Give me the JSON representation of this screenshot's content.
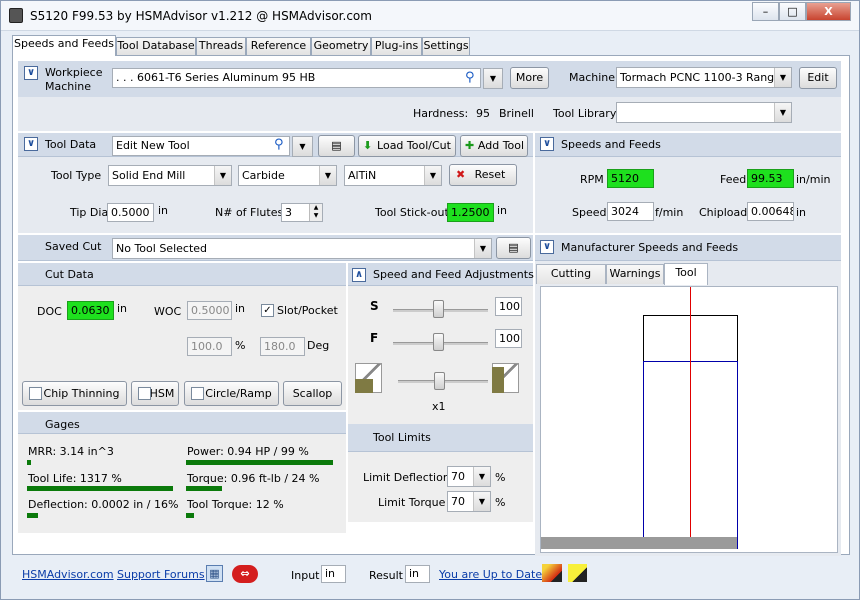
{
  "window": {
    "title": "S5120 F99.53 by HSMAdvisor v1.212 @ HSMAdvisor.com",
    "minimize": "–",
    "maximize": "□",
    "close": "X"
  },
  "tabs": [
    "Speeds and Feeds",
    "Tool Database",
    "Threads",
    "Reference",
    "Geometry",
    "Plug-ins",
    "Settings"
  ],
  "workpiece": {
    "label_line1": "Workpiece",
    "label_line2": "Machine",
    "material": ". . . 6061-T6 Series Aluminum 95 HB",
    "more_button": "More",
    "machine_label": "Machine",
    "machine_value": "Tormach PCNC 1100-3 Range 2(",
    "edit_button": "Edit",
    "hardness_label": "Hardness:",
    "hardness_value": "95",
    "hardness_unit": "Brinell",
    "tool_library_label": "Tool Library",
    "tool_library_value": ""
  },
  "tool_data": {
    "header": "Tool Data",
    "tool_name": "Edit New Tool",
    "load_button": "Load Tool/Cut",
    "add_button": "Add Tool",
    "tool_type_label": "Tool Type",
    "tool_type_value": "Solid End Mill",
    "material_value": "Carbide",
    "coating_value": "AlTiN",
    "reset_button": "Reset",
    "tip_dia_label": "Tip Dia",
    "tip_dia_value": "0.5000",
    "tip_dia_unit": "in",
    "flutes_label": "N# of Flutes",
    "flutes_value": "3",
    "stickout_label": "Tool Stick-out",
    "stickout_value": "1.2500",
    "stickout_unit": "in"
  },
  "saved_cut": {
    "label": "Saved Cut",
    "value": "No Tool Selected"
  },
  "speeds_feeds": {
    "header": "Speeds and Feeds",
    "rpm_label": "RPM",
    "rpm_value": "5120",
    "feed_label": "Feed",
    "feed_value": "99.53",
    "feed_unit": "in/min",
    "speed_label": "Speed",
    "speed_value": "3024",
    "speed_unit": "f/min",
    "chipload_label": "Chipload",
    "chipload_value": "0.00648",
    "chipload_unit": "in"
  },
  "manufacturer": {
    "header": "Manufacturer Speeds and Feeds",
    "tabs": [
      "Cutting Data",
      "Warnings",
      "Tool"
    ]
  },
  "cut_data": {
    "header": "Cut Data",
    "doc_label": "DOC",
    "doc_value": "0.0630",
    "doc_unit": "in",
    "woc_label": "WOC",
    "woc_value": "0.5000",
    "woc_unit": "in",
    "slot_label": "Slot/Pocket",
    "slot_checked": "✓",
    "pct_value": "100.0",
    "pct_unit": "%",
    "deg_value": "180.0",
    "deg_unit": "Deg",
    "chip_thinning": "Chip Thinning",
    "hsm": "HSM",
    "circle_ramp": "Circle/Ramp",
    "scallop": "Scallop"
  },
  "adjustments": {
    "header": "Speed and Feed Adjustments",
    "s_label": "S",
    "s_value": "100",
    "f_label": "F",
    "f_value": "100",
    "multiplier": "x1"
  },
  "gages": {
    "header": "Gages",
    "mrr": "MRR: 3.14 in^3",
    "power": "Power: 0.94 HP / 99 %",
    "tool_life": "Tool Life: 1317 %",
    "torque": "Torque: 0.96 ft-lb / 24 %",
    "deflection": "Deflection: 0.0002 in / 16%",
    "tool_torque": "Tool Torque: 12 %"
  },
  "tool_limits": {
    "header": "Tool Limits",
    "deflection_label": "Limit Deflection",
    "deflection_value": "70",
    "deflection_unit": "%",
    "torque_label": "Limit Torque",
    "torque_value": "70",
    "torque_unit": "%"
  },
  "footer": {
    "hsmadvisor_link": "HSMAdvisor.com",
    "forums_link": "Support Forums",
    "input_label": "Input",
    "input_value": "in",
    "result_label": "Result",
    "result_value": "in",
    "update_link": "You are Up to Date"
  },
  "colors": {
    "green_field": "#1ee01e",
    "header_blue": "#d2dbe8",
    "gauge_bar": "#0b7a0b",
    "link": "#0a3ca8"
  }
}
